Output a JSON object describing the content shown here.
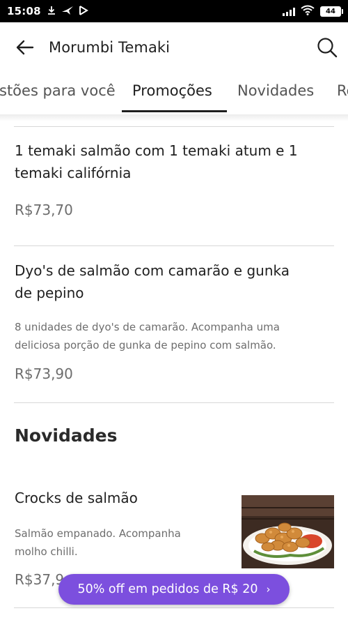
{
  "status_bar": {
    "time": "15:08",
    "battery": "44",
    "icons": [
      "download-icon",
      "bird-icon",
      "play-icon",
      "signal-icon",
      "wifi-icon",
      "battery-icon"
    ]
  },
  "header": {
    "title": "Morumbi Temaki",
    "back_icon": "back-arrow-icon",
    "search_icon": "search-icon"
  },
  "tabs": [
    {
      "label": "stões para você",
      "active": false
    },
    {
      "label": "Promoções",
      "active": true
    },
    {
      "label": "Novidades",
      "active": false
    },
    {
      "label": "Re",
      "active": false
    }
  ],
  "promocoes": {
    "items": [
      {
        "title_lines": [
          "1 temaki salmão com 1 temaki atum e 1",
          "temaki califórnia"
        ],
        "description_lines": [],
        "price": "R$73,70"
      },
      {
        "title_lines": [
          "Dyo's de salmão com camarão e gunka",
          "de pepino"
        ],
        "description_lines": [
          "8 unidades de dyo's de camarão. Acompanha uma",
          "deliciosa porção de gunka de pepino com salmão."
        ],
        "price": "R$73,90"
      }
    ]
  },
  "novidades": {
    "section_title": "Novidades",
    "items": [
      {
        "title": "Crocks de salmão",
        "description_lines": [
          "Salmão empanado. Acompanha",
          "molho chilli."
        ],
        "price": "R$37,9"
      }
    ]
  },
  "promo_banner": {
    "label": "50% off em pedidos de R$ 20",
    "chevron": "›"
  },
  "colors": {
    "accent": "#7c4fde",
    "text_primary": "#1f1f1f",
    "text_secondary": "#6d6d6d",
    "divider": "#d7d7d7"
  }
}
